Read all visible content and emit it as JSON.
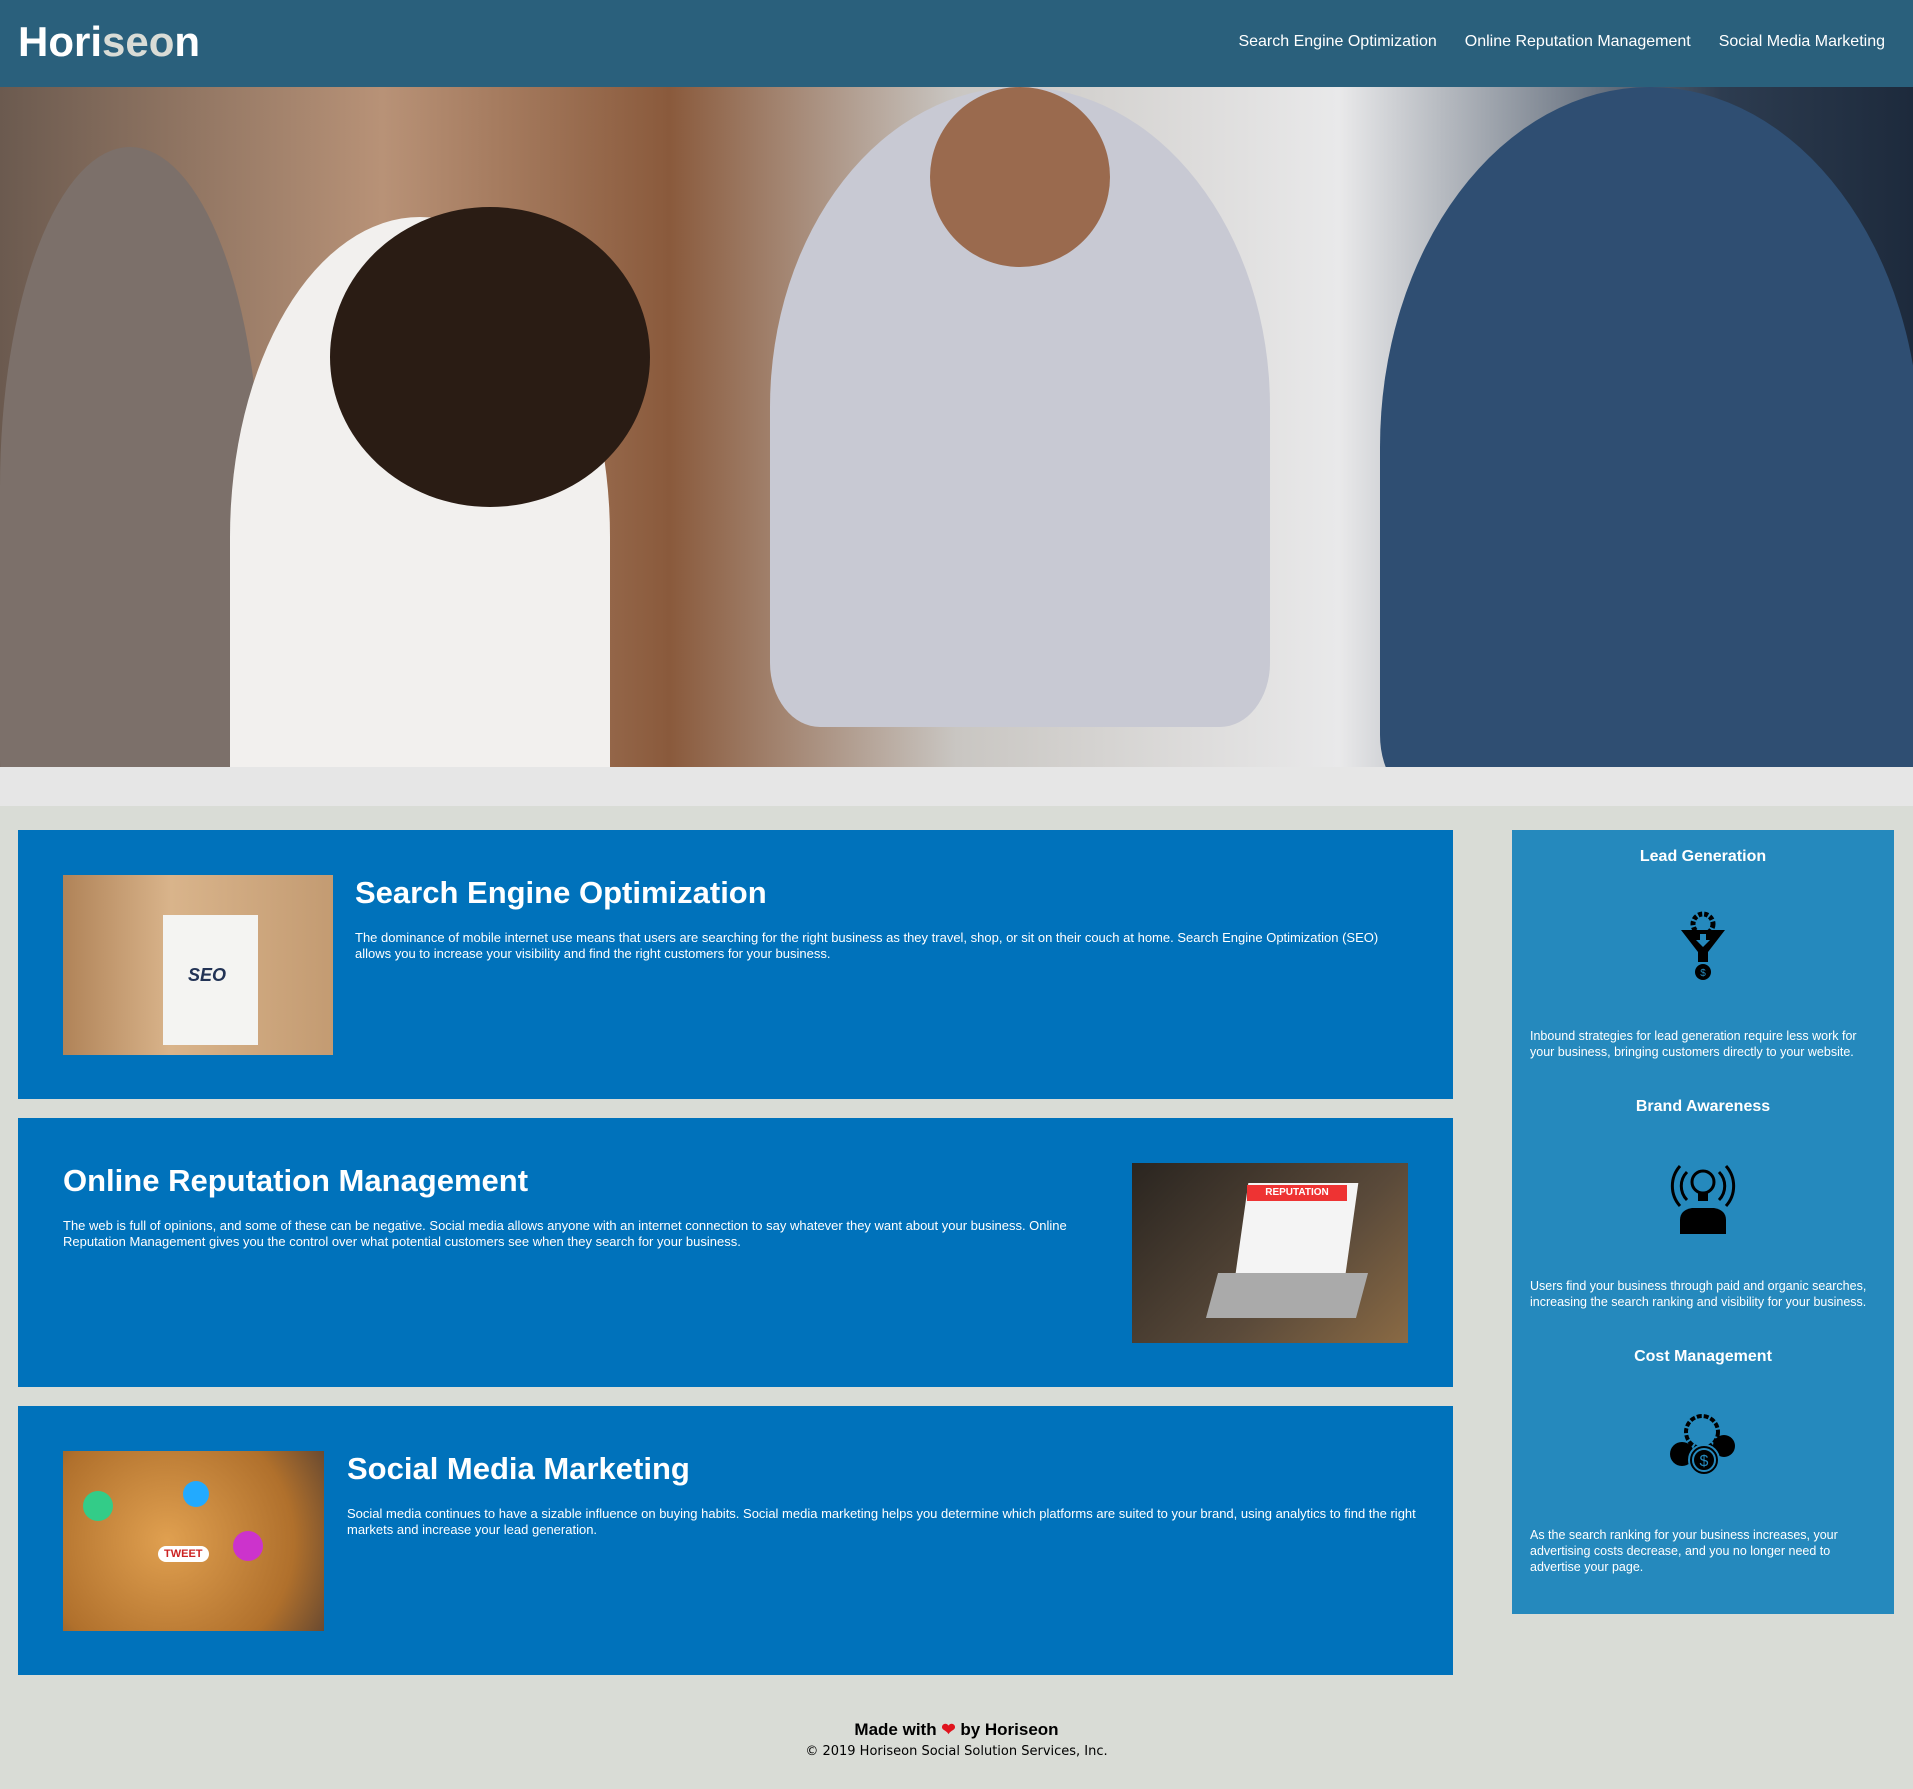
{
  "header": {
    "logo_main": "Hori",
    "logo_accent": "seo",
    "logo_rest": "n",
    "nav": [
      {
        "label": "Search Engine Optimization"
      },
      {
        "label": "Online Reputation Management"
      },
      {
        "label": "Social Media Marketing"
      }
    ]
  },
  "hero": {
    "alt": "people working at a table"
  },
  "content": [
    {
      "title": "Search Engine Optimization",
      "text": "The dominance of mobile internet use means that users are searching for the right business as they travel, shop, or sit on their couch at home. Search Engine Optimization (SEO) allows you to increase your visibility and find the right customers for your business.",
      "image_label": "SEO"
    },
    {
      "title": "Online Reputation Management",
      "text": "The web is full of opinions, and some of these can be negative. Social media allows anyone with an internet connection to say whatever they want about your business. Online Reputation Management gives you the control over what potential customers see when they search for your business.",
      "image_label": "REPUTATION"
    },
    {
      "title": "Social Media Marketing",
      "text": "Social media continues to have a sizable influence on buying habits. Social media marketing helps you determine which platforms are suited to your brand, using analytics to find the right markets and increase your lead generation.",
      "image_label": "TWEET"
    }
  ],
  "benefits": [
    {
      "title": "Lead Generation",
      "icon": "funnel-gear-dollar-icon",
      "text": "Inbound strategies for lead generation require less work for your business, bringing customers directly to your website."
    },
    {
      "title": "Brand Awareness",
      "icon": "lightbulb-person-icon",
      "text": "Users find your business through paid and organic searches, increasing the search ranking and visibility for your business."
    },
    {
      "title": "Cost Management",
      "icon": "gear-coins-icon",
      "text": "As the search ranking for your business increases, your advertising costs decrease, and you no longer need to advertise your page."
    }
  ],
  "footer": {
    "made_prefix": "Made with",
    "made_suffix": "by Horiseon",
    "copyright": "© 2019 Horiseon Social Solution Services, Inc."
  },
  "colors": {
    "header": "#2a607c",
    "card": "#0072bb",
    "aside": "#2589bd",
    "background": "#d9dcd6",
    "heart": "#e0141e"
  }
}
